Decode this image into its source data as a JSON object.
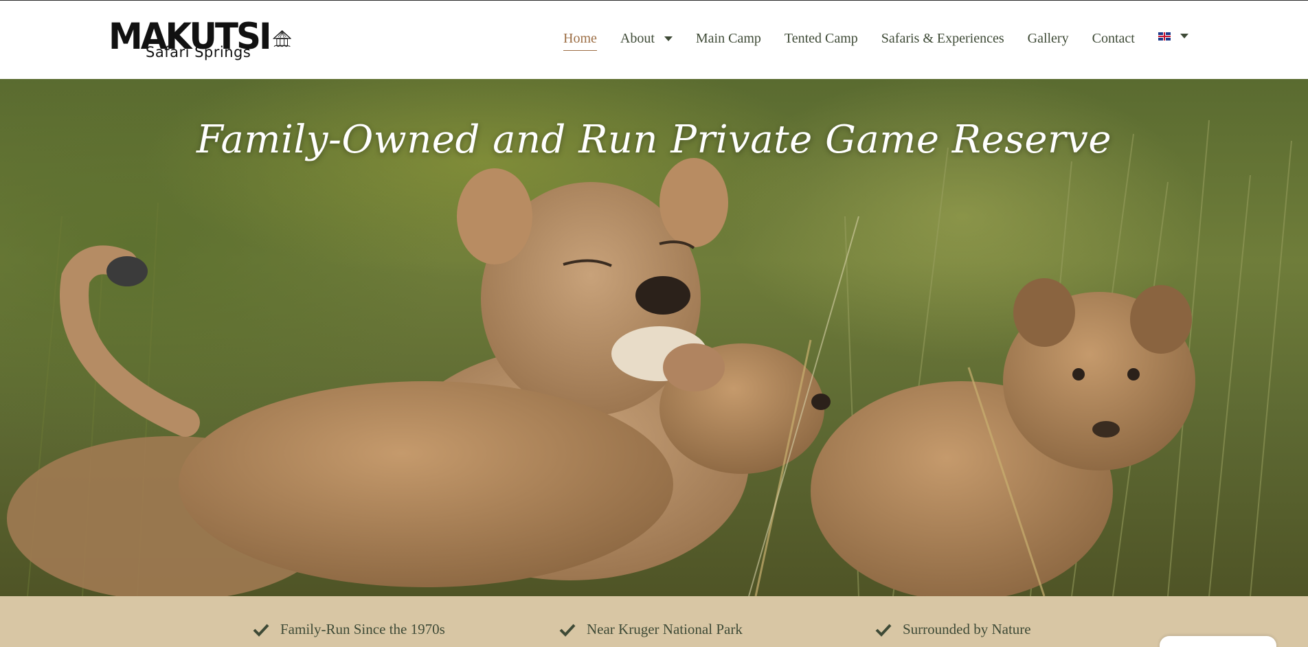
{
  "brand": {
    "name": "MAKUTSI",
    "subtitle": "Safari Springs"
  },
  "nav": {
    "items": [
      {
        "label": "Home",
        "active": true
      },
      {
        "label": "About",
        "dropdown": true
      },
      {
        "label": "Main Camp"
      },
      {
        "label": "Tented Camp"
      },
      {
        "label": "Safaris & Experiences"
      },
      {
        "label": "Gallery"
      },
      {
        "label": "Contact"
      }
    ],
    "language_icon": "uk-flag-icon"
  },
  "hero": {
    "title": "Family-Owned and Run Private Game Reserve"
  },
  "features": [
    {
      "icon": "check-icon",
      "label": "Family-Run Since the 1970s"
    },
    {
      "icon": "check-icon",
      "label": "Near Kruger National Park"
    },
    {
      "icon": "check-icon",
      "label": "Surrounded by Nature"
    }
  ],
  "colors": {
    "nav_text": "#3e4a36",
    "nav_active": "#9c6e45",
    "features_bg": "#d8c6a4"
  }
}
